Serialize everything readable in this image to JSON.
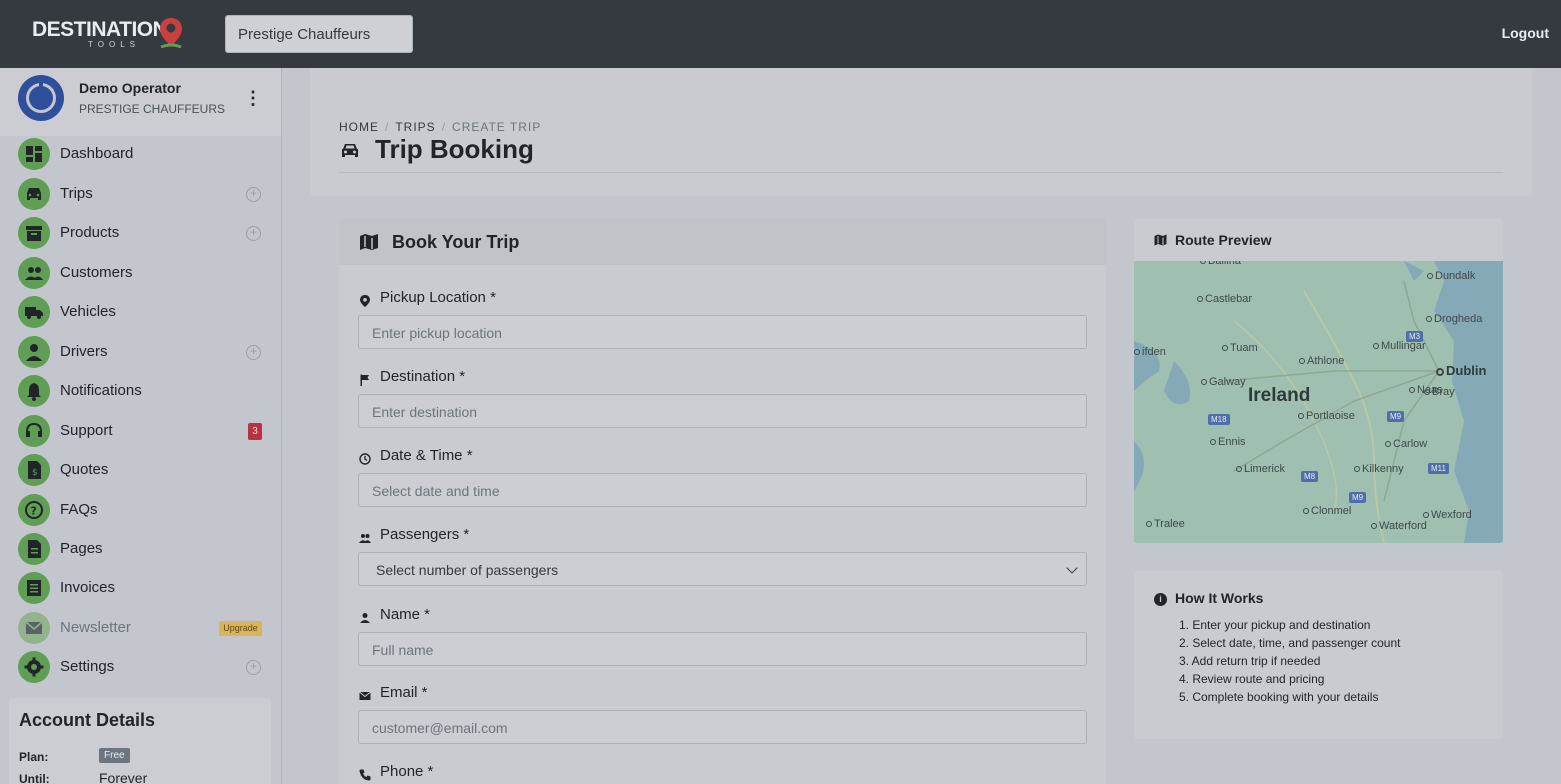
{
  "topbar": {
    "logo_text": "DESTINATION",
    "logo_sub": "TOOLS",
    "company_selected": "Prestige Chauffeurs",
    "logout_label": "Logout"
  },
  "user": {
    "name": "Demo Operator",
    "company": "PRESTIGE CHAUFFEURS"
  },
  "sidebar": {
    "items": [
      {
        "label": "Dashboard",
        "icon": "dashboard-icon"
      },
      {
        "label": "Trips",
        "icon": "car-icon",
        "add": true
      },
      {
        "label": "Products",
        "icon": "archive-icon",
        "add": true
      },
      {
        "label": "Customers",
        "icon": "people-icon"
      },
      {
        "label": "Vehicles",
        "icon": "truck-icon"
      },
      {
        "label": "Drivers",
        "icon": "person-icon",
        "add": true
      },
      {
        "label": "Notifications",
        "icon": "bell-icon"
      },
      {
        "label": "Support",
        "icon": "support-icon",
        "badge": "3"
      },
      {
        "label": "Quotes",
        "icon": "quote-icon"
      },
      {
        "label": "FAQs",
        "icon": "question-icon"
      },
      {
        "label": "Pages",
        "icon": "page-icon"
      },
      {
        "label": "Invoices",
        "icon": "invoice-icon"
      },
      {
        "label": "Newsletter",
        "icon": "mail-icon",
        "badge": "Upgrade"
      },
      {
        "label": "Settings",
        "icon": "gear-icon",
        "add": true
      }
    ]
  },
  "account": {
    "title": "Account Details",
    "plan_label": "Plan:",
    "plan_value": "Free",
    "until_label": "Until:",
    "until_value": "Forever"
  },
  "header": {
    "breadcrumb": [
      "HOME",
      "TRIPS",
      "CREATE TRIP"
    ],
    "title": "Trip Booking"
  },
  "booking": {
    "title": "Book Your Trip",
    "fields": [
      {
        "label": "Pickup Location *",
        "placeholder": "Enter pickup location"
      },
      {
        "label": "Destination *",
        "placeholder": "Enter destination"
      },
      {
        "label": "Date & Time *",
        "placeholder": "Select date and time"
      },
      {
        "label": "Passengers *",
        "placeholder": "Select number of passengers"
      },
      {
        "label": "Name *",
        "placeholder": "Full name"
      },
      {
        "label": "Email *",
        "placeholder": "customer@email.com"
      },
      {
        "label": "Phone *",
        "placeholder": ""
      }
    ]
  },
  "route": {
    "title": "Route Preview",
    "map_labels": {
      "country": "Ireland",
      "dublin": "Dublin",
      "places": [
        "Ballina",
        "Dundalk",
        "Castlebar",
        "Drogheda",
        "ifden",
        "Tuam",
        "Mullingar",
        "Athlone",
        "Galway",
        "Naas",
        "Bray",
        "Portlaoise",
        "Ennis",
        "Carlow",
        "Limerick",
        "Kilkenny",
        "Clonmel",
        "Tralee",
        "Waterford",
        "Wexford"
      ],
      "roads": [
        "M3",
        "M18",
        "M9",
        "M8",
        "M9",
        "M11"
      ]
    }
  },
  "how": {
    "title": "How It Works",
    "steps": [
      "1. Enter your pickup and destination",
      "2. Select date, time, and passenger count",
      "3. Add return trip if needed",
      "4. Review route and pricing",
      "5. Complete booking with your details"
    ]
  }
}
